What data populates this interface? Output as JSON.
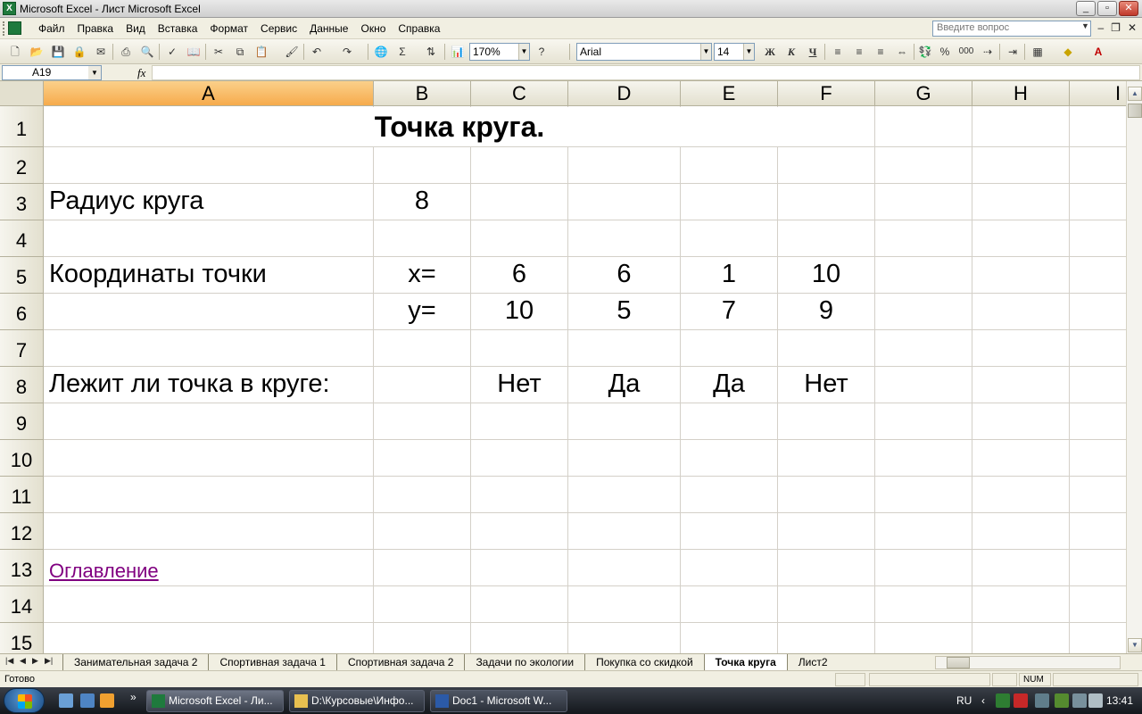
{
  "window": {
    "title": "Microsoft Excel - Лист Microsoft Excel",
    "buttons": [
      "_",
      "▫",
      "✕"
    ]
  },
  "menu": {
    "items": [
      "Файл",
      "Правка",
      "Вид",
      "Вставка",
      "Формат",
      "Сервис",
      "Данные",
      "Окно",
      "Справка"
    ],
    "ask_placeholder": "Введите вопрос",
    "mdi_buttons": [
      "–",
      "❐",
      "✕"
    ]
  },
  "toolbar": {
    "zoom": "170%",
    "font": "Arial",
    "font_size": "14",
    "bold": "Ж",
    "italic": "К",
    "underline": "Ч",
    "sigma": "Σ",
    "percent": "%",
    "thousands": "000"
  },
  "formula_bar": {
    "name_box": "A19",
    "fx": "fx",
    "formula": ""
  },
  "columns": [
    "A",
    "B",
    "C",
    "D",
    "E",
    "F",
    "G",
    "H",
    "I"
  ],
  "selected_column": "A",
  "rows": [
    "1",
    "2",
    "3",
    "4",
    "5",
    "6",
    "7",
    "8",
    "9",
    "10",
    "11",
    "12",
    "13",
    "14",
    "15"
  ],
  "sheet": {
    "title": "Точка круга.",
    "radius_label": "Радиус круга",
    "radius_value": "8",
    "coords_label": "Координаты точки",
    "x_label": "x=",
    "y_label": "y=",
    "x_values": [
      "6",
      "6",
      "1",
      "10"
    ],
    "y_values": [
      "10",
      "5",
      "7",
      "9"
    ],
    "inside_label": "Лежит ли точка в круге:",
    "inside_values": [
      "Нет",
      "Да",
      "Да",
      "Нет"
    ],
    "link": "Оглавление"
  },
  "tabs": {
    "items": [
      "Занимательная задача 2",
      "Спортивная задача 1",
      "Спортивная задача 2",
      "Задачи по экологии",
      "Покупка со скидкой",
      "Точка круга",
      "Лист2"
    ],
    "active": "Точка круга"
  },
  "status": {
    "ready": "Готово",
    "num": "NUM"
  },
  "taskbar": {
    "buttons": [
      "Microsoft Excel - Ли...",
      "D:\\Курсовые\\Инфо...",
      "Doc1 - Microsoft W..."
    ],
    "lang": "RU",
    "clock": "13:41"
  }
}
